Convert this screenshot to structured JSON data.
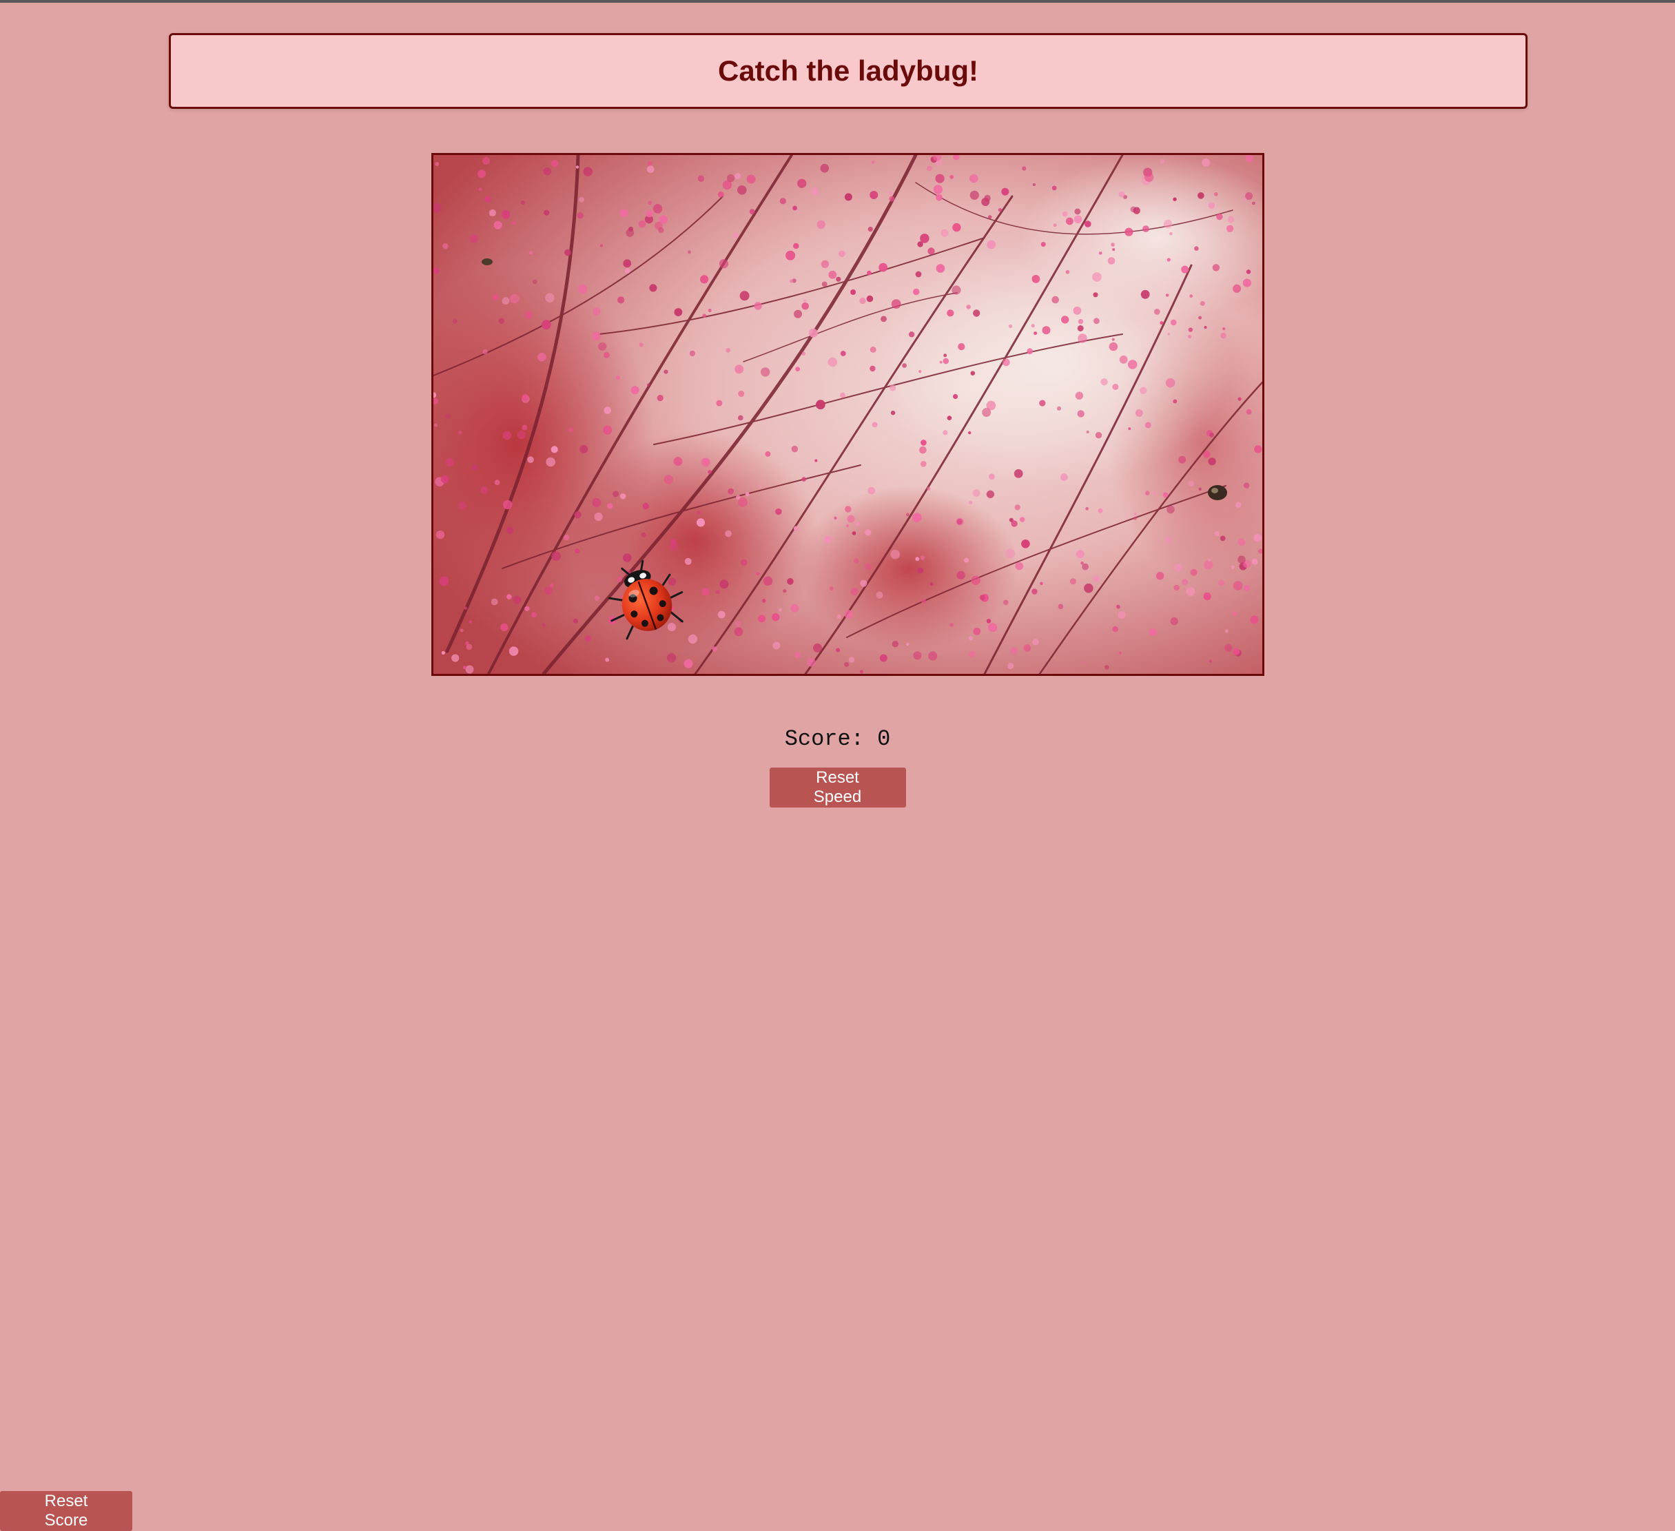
{
  "header": {
    "title": "Catch the ladybug!"
  },
  "game": {
    "score_label": "Score:",
    "score_value": "0",
    "character": "ladybug-icon",
    "background": "pink-blossom-branches"
  },
  "controls": {
    "reset_speed_label": "Reset Speed",
    "reset_score_label": "Reset Score"
  },
  "colors": {
    "page_bg": "#e0a4a5",
    "header_bg": "#f8c8ca",
    "accent": "#6b0a0a",
    "button_bg": "#b85552"
  }
}
